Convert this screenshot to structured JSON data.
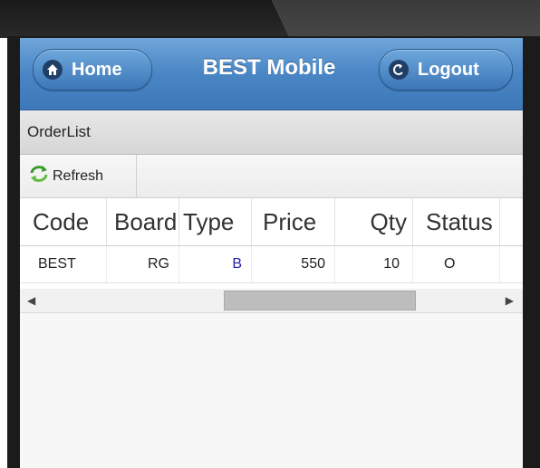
{
  "header": {
    "title": "BEST Mobile",
    "home_label": "Home",
    "logout_label": "Logout"
  },
  "section": {
    "title": "OrderList"
  },
  "toolbar": {
    "refresh_label": "Refresh"
  },
  "grid": {
    "columns": [
      "Code",
      "Board",
      "Type",
      "Price",
      "Qty",
      "Status"
    ],
    "rows": [
      [
        "BEST",
        "RG",
        "B",
        "550",
        "10",
        "O"
      ]
    ]
  },
  "colors": {
    "header_blue": "#4a86c6",
    "type_value": "#2222aa"
  }
}
